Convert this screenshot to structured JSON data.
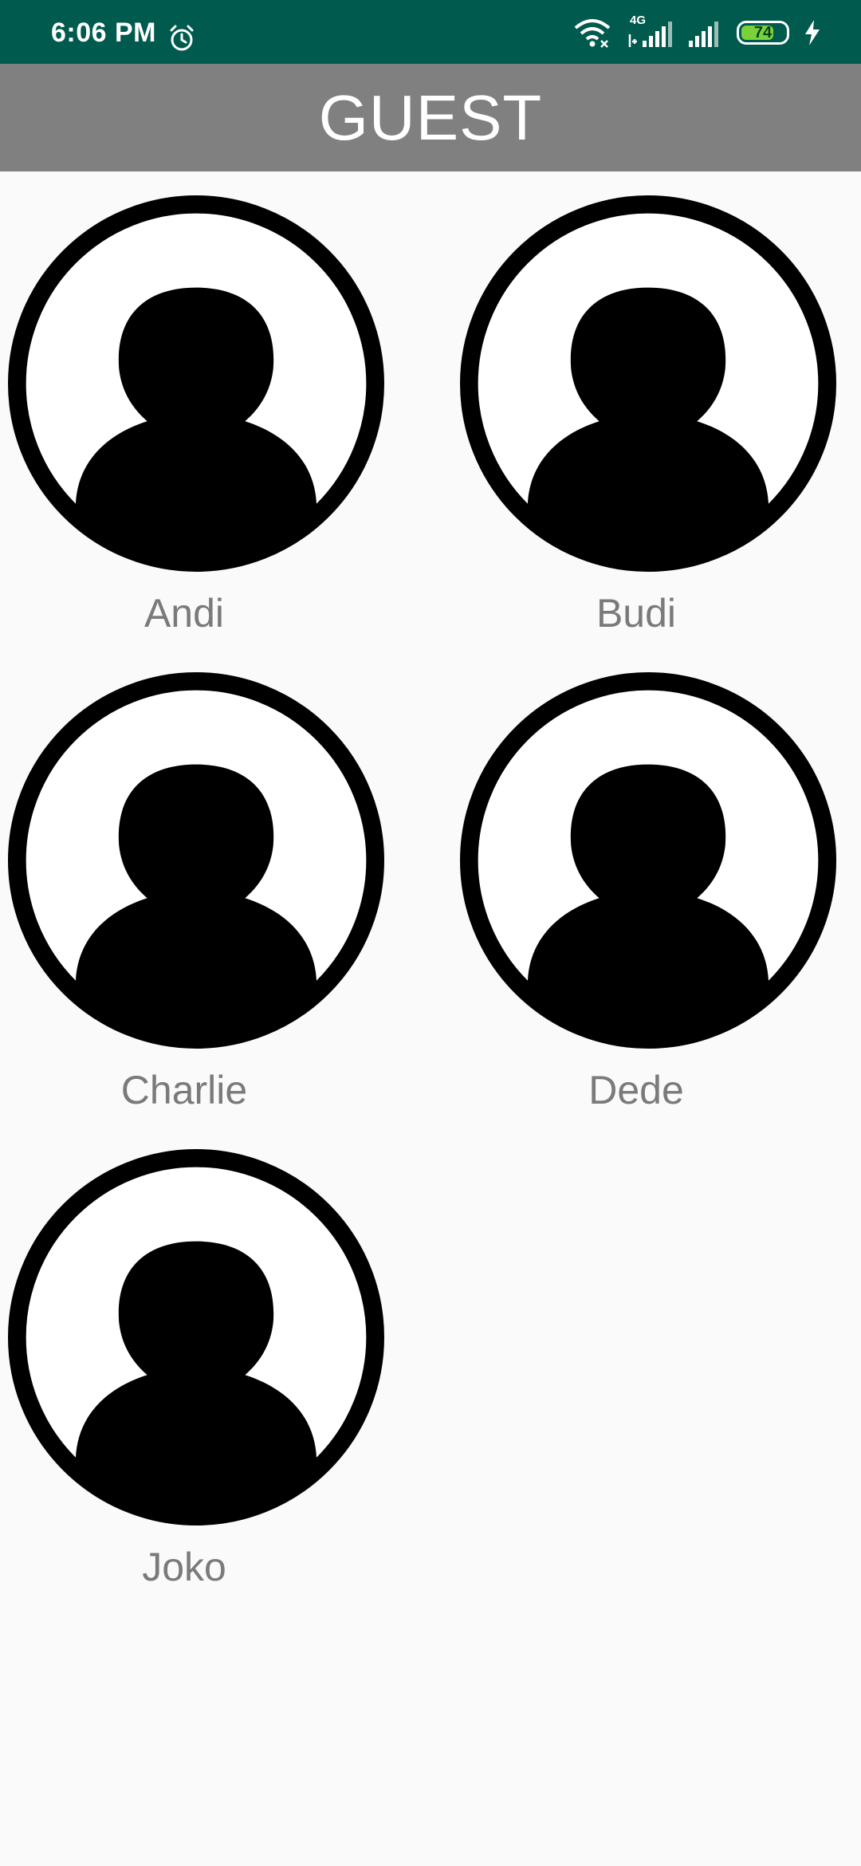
{
  "status_bar": {
    "time": "6:06 PM",
    "network_label": "4G",
    "battery_level": "74",
    "battery_percent": 74,
    "icons": [
      "alarm-icon",
      "wifi-icon",
      "signal-icon",
      "signal-icon",
      "battery-icon",
      "charging-icon"
    ]
  },
  "app_bar": {
    "title": "GUEST"
  },
  "guests": [
    {
      "name": "Andi",
      "icon": "person-avatar-icon"
    },
    {
      "name": "Budi",
      "icon": "person-avatar-icon"
    },
    {
      "name": "Charlie",
      "icon": "person-avatar-icon"
    },
    {
      "name": "Dede",
      "icon": "person-avatar-icon"
    },
    {
      "name": "Joko",
      "icon": "person-avatar-icon"
    }
  ],
  "colors": {
    "status_bar": "#005a4e",
    "app_bar": "#808080",
    "background": "#fafafa",
    "name_text": "#7a7a7a",
    "battery": "#7ad23a"
  }
}
